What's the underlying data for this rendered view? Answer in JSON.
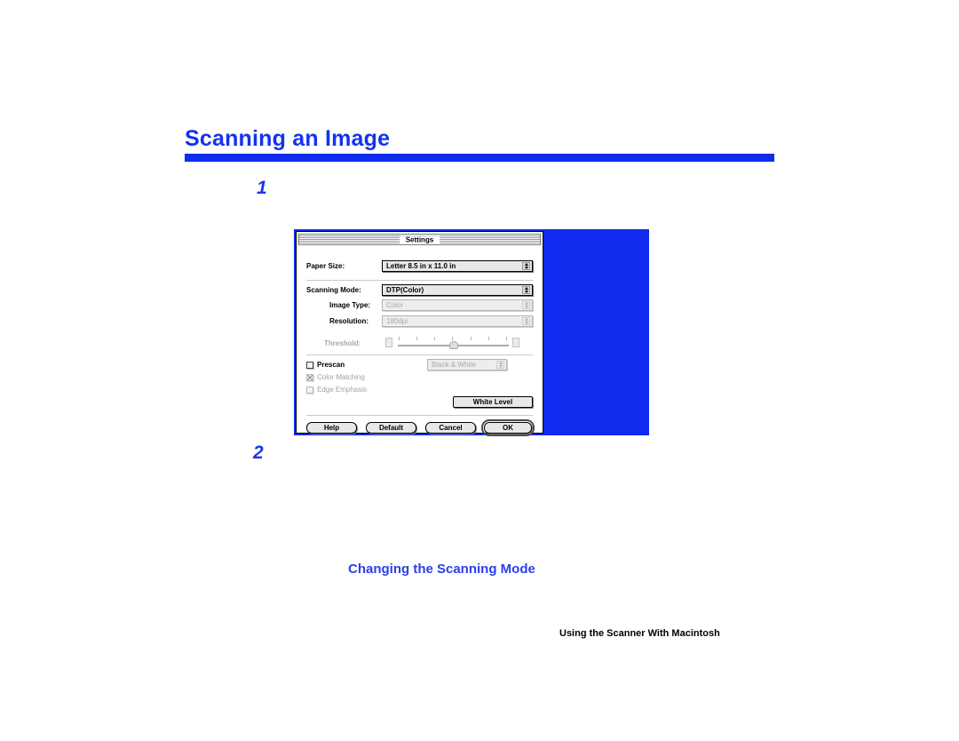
{
  "heading": {
    "title": "Scanning an Image"
  },
  "steps": [
    {
      "number": "1"
    },
    {
      "number": "2"
    }
  ],
  "dialog": {
    "title": "Settings",
    "fields": [
      {
        "label": "Paper Size:",
        "value": "Letter 8.5 in x 11.0 in",
        "enabled": true
      },
      {
        "label": "Scanning Mode:",
        "value": "DTP(Color)",
        "enabled": true
      },
      {
        "label": "Image Type:",
        "value": "Color",
        "enabled": false
      },
      {
        "label": "Resolution:",
        "value": "180dpi",
        "enabled": false
      }
    ],
    "threshold": {
      "label": "Threshold:",
      "enabled": false,
      "tick_count": 7,
      "thumb_percent": 50
    },
    "checkboxes": [
      {
        "label": "Prescan",
        "checked": false,
        "enabled": true
      },
      {
        "label": "Color Matching",
        "checked": true,
        "enabled": false
      },
      {
        "label": "Edge Emphasis",
        "checked": false,
        "enabled": false
      }
    ],
    "mode_popup": {
      "value": "Black & White",
      "enabled": false
    },
    "white_level_button": "White Level",
    "buttons": [
      {
        "label": "Help",
        "default": false
      },
      {
        "label": "Default",
        "default": false
      },
      {
        "label": "Cancel",
        "default": false
      },
      {
        "label": "OK",
        "default": true
      }
    ]
  },
  "section_title": "Changing the Scanning Mode",
  "footer": "Using the Scanner With Macintosh",
  "colors": {
    "accent_blue": "#0f2cee",
    "heading_blue": "#1333ef",
    "section_blue": "#2a3fee"
  }
}
